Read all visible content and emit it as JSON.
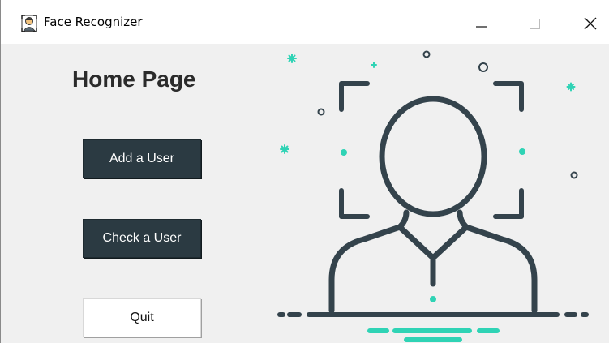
{
  "window": {
    "title": "Face Recognizer",
    "controls": {
      "minimize": "minimize",
      "maximize": "maximize",
      "close": "close"
    }
  },
  "main": {
    "heading": "Home Page",
    "buttons": {
      "add_user": "Add a User",
      "check_user": "Check a User",
      "quit": "Quit"
    }
  },
  "colors": {
    "button_dark": "#2b3a42",
    "illustration_line": "#34434c",
    "accent": "#2fd3b5",
    "background": "#f0f0f0"
  },
  "icons": {
    "app": "face-recognition-app-icon",
    "illustration": "face-recognition-user-illustration"
  }
}
